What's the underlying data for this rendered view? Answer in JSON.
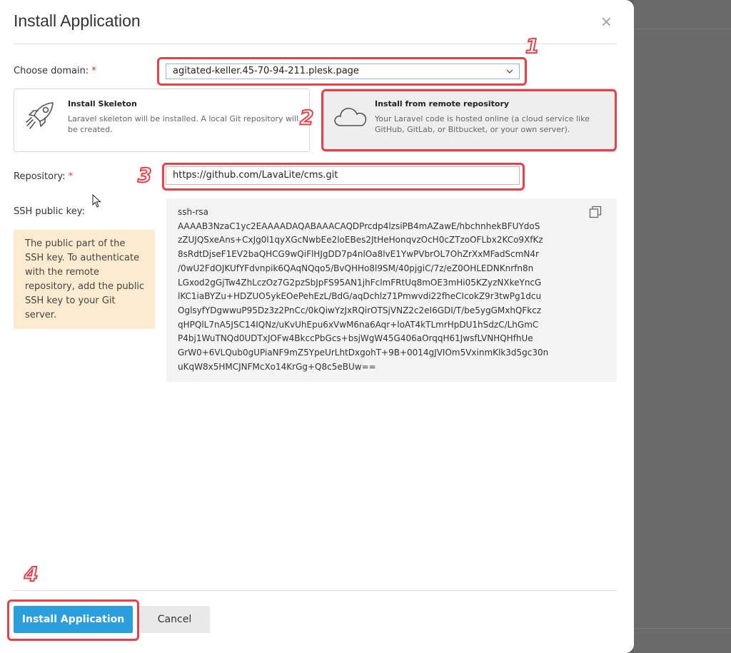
{
  "dialog": {
    "title": "Install Application",
    "close_glyph": "×"
  },
  "domain": {
    "label": "Choose domain:",
    "required": "*",
    "value": "agitated-keller.45-70-94-211.plesk.page"
  },
  "options": [
    {
      "title": "Install Skeleton",
      "description": "Laravel skeleton will be installed. A local Git repository will be created.",
      "icon": "rocket-icon",
      "selected": false
    },
    {
      "title": "Install from remote repository",
      "description": "Your Laravel code is hosted online (a cloud service like GitHub, GitLab, or Bitbucket, or your own server).",
      "icon": "cloud-icon",
      "selected": true
    }
  ],
  "repository": {
    "label": "Repository:",
    "required": "*",
    "value": "https://github.com/LavaLite/cms.git"
  },
  "ssh": {
    "label": "SSH public key:",
    "hint": "The public part of the SSH key. To authenticate with the remote repository, add the public SSH key to your Git server.",
    "key_lines": [
      "ssh-rsa",
      "AAAAB3NzaC1yc2EAAAADAQABAAACAQDPrcdp4lzsiPB4mAZawE/hbchnhekBFUYdoS",
      "zZUJQSxeAns+CxJg0l1qyXGcNwbEe2loEBes2JtHeHonqvzOcH0cZTzoOFLbx2KCo9XfKz",
      "8sRdtDjseF1EV2baQHCG9wQiFlHJgDD7p4nlOa8lvE1YwPVbrOL7OhZrXxMFadScmN4r",
      "/0wU2FdOJKUfYFdvnpik6QAqNQqo5/BvQHHo8l9SM/40pjgiC/7z/eZ0OHLEDNKnrfn8n",
      "LGxod2gGjTw4ZhLczOz7G2pzSbJpFS95AN1jhFclmFRtUq8mOE3mHi05KZyzNXkeYncG",
      "lKC1iaBYZu+HDZUO5ykEOePehEzL/BdG/aqDchlz71Pmwvdi22fheCIcokZ9r3twPg1dcu",
      "OglsyfYDgwwuP95Dz3z2PnCc/0kQiwYzJxRQirOTSjVNZ2c2eI6GDI/T/be5ygGMxhQFkcz",
      "qHPQlL7nA5JSC14IQNz/uKvUhEpu6xVwM6na6Aqr+loAT4kTLmrHpDU1hSdzC/LhGmC",
      "P4bj1WuTNQd0UDTxJOFw4BkccPbGcs+bsjWgW45G406aOrqqH61JwsfLVNHQHfhUe",
      "GrW0+6VLQub0gUPiaNF9mZ5YpeUrLhtDxgohT+9B+0014gJVIOm5VxinmKlk3d5gc30n",
      "uKqW8x5HMCJNFMcXo14KrGg+Q8c5eBUw=="
    ],
    "copy_icon": "copy-icon"
  },
  "footer": {
    "install_label": "Install Application",
    "cancel_label": "Cancel"
  },
  "annotations": {
    "step1": "1",
    "step2": "2",
    "step3": "3",
    "step4": "4",
    "color": "#e5414b"
  },
  "colors": {
    "primary": "#2b9fde",
    "hint_bg": "#fdebcf",
    "required": "#e3402e"
  }
}
